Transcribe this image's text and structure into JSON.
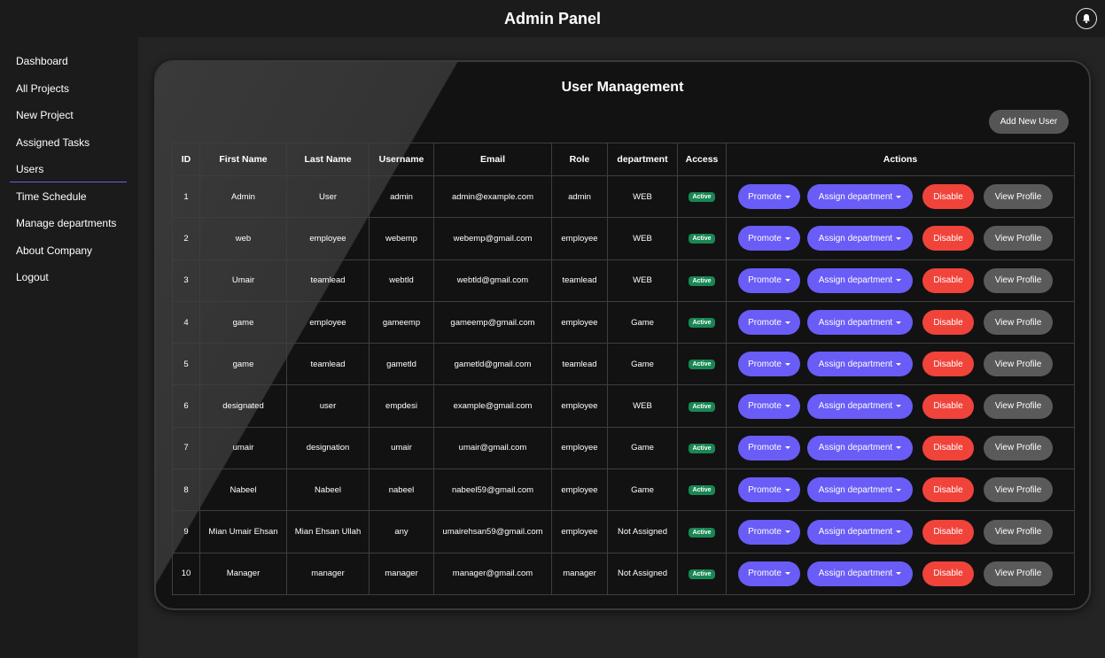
{
  "header": {
    "title": "Admin Panel",
    "bell_icon": "bell-icon"
  },
  "sidebar": {
    "items": [
      {
        "label": "Dashboard"
      },
      {
        "label": "All Projects"
      },
      {
        "label": "New Project"
      },
      {
        "label": "Assigned Tasks"
      },
      {
        "label": "Users"
      },
      {
        "label": "Time Schedule"
      },
      {
        "label": "Manage departments"
      },
      {
        "label": "About Company"
      },
      {
        "label": "Logout"
      }
    ],
    "active_item": "Users",
    "active_color": "#6c5ce7"
  },
  "main": {
    "title": "User Management",
    "add_button": "Add New User",
    "table": {
      "headers": [
        "ID",
        "First Name",
        "Last Name",
        "Username",
        "Email",
        "Role",
        "department",
        "Access",
        "Actions"
      ],
      "rows": [
        {
          "id": "1",
          "first": "Admin",
          "last": "User",
          "username": "admin",
          "email": "admin@example.com",
          "role": "admin",
          "department": "WEB",
          "access": "Active"
        },
        {
          "id": "2",
          "first": "web",
          "last": "employee",
          "username": "webemp",
          "email": "webemp@gmail.com",
          "role": "employee",
          "department": "WEB",
          "access": "Active"
        },
        {
          "id": "3",
          "first": "Umair",
          "last": "teamlead",
          "username": "webtld",
          "email": "webtld@gmail.com",
          "role": "teamlead",
          "department": "WEB",
          "access": "Active"
        },
        {
          "id": "4",
          "first": "game",
          "last": "employee",
          "username": "gameemp",
          "email": "gameemp@gmail.com",
          "role": "employee",
          "department": "Game",
          "access": "Active"
        },
        {
          "id": "5",
          "first": "game",
          "last": "teamlead",
          "username": "gametld",
          "email": "gametld@gmail.com",
          "role": "teamlead",
          "department": "Game",
          "access": "Active"
        },
        {
          "id": "6",
          "first": "designated",
          "last": "user",
          "username": "empdesi",
          "email": "example@gmail.com",
          "role": "employee",
          "department": "WEB",
          "access": "Active"
        },
        {
          "id": "7",
          "first": "umair",
          "last": "designation",
          "username": "umair",
          "email": "umair@gmail.com",
          "role": "employee",
          "department": "Game",
          "access": "Active"
        },
        {
          "id": "8",
          "first": "Nabeel",
          "last": "Nabeel",
          "username": "nabeel",
          "email": "nabeel59@gmail.com",
          "role": "employee",
          "department": "Game",
          "access": "Active"
        },
        {
          "id": "9",
          "first": "Mian Umair Ehsan",
          "last": "Mian Ehsan Ullah",
          "username": "any",
          "email": "umairehsan59@gmail.com",
          "role": "employee",
          "department": "Not Assigned",
          "access": "Active"
        },
        {
          "id": "10",
          "first": "Manager",
          "last": "manager",
          "username": "manager",
          "email": "manager@gmail.com",
          "role": "manager",
          "department": "Not Assigned",
          "access": "Active"
        }
      ],
      "actions": {
        "promote": "Promote",
        "assign": "Assign department",
        "disable": "Disable",
        "view": "View Profile"
      }
    }
  },
  "colors": {
    "primary": "#6a5cf6",
    "danger": "#f0433a",
    "secondary": "#5a5a5a",
    "success": "#198754"
  }
}
